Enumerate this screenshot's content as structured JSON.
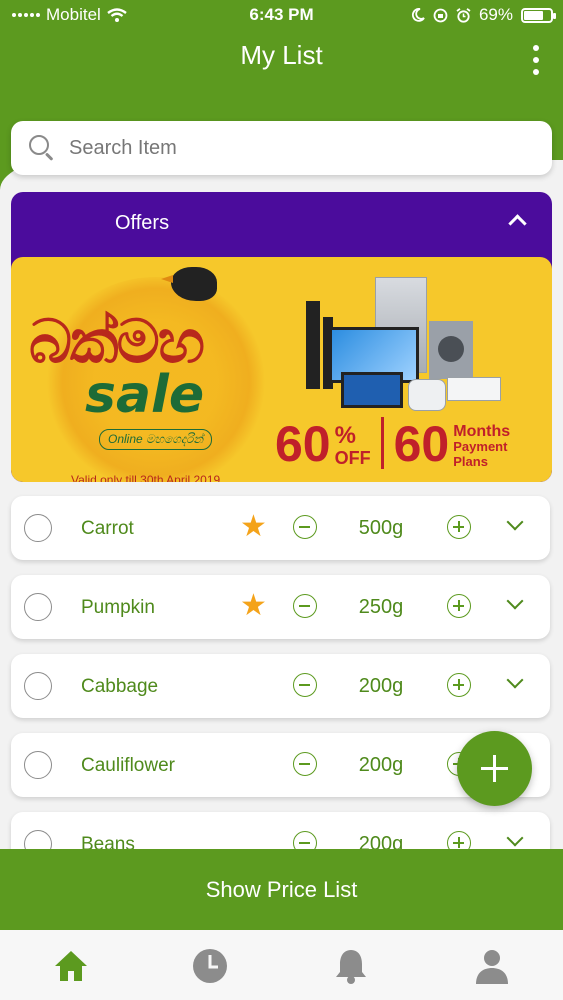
{
  "status_bar": {
    "carrier": "Mobitel",
    "time": "6:43 PM",
    "battery": "69%",
    "battery_level": 0.69
  },
  "header": {
    "title": "My List"
  },
  "search": {
    "placeholder": "Search Item"
  },
  "offers": {
    "title": "Offers",
    "banner": {
      "title": "බක්මහ",
      "sale": "sale",
      "subtitle": "Online මහගෙදරින්",
      "valid": "Valid only till 30th April 2019",
      "discount": "60",
      "discount_unit": "%",
      "discount_label": "OFF",
      "months": "60",
      "months_label_1": "Months",
      "months_label_2": "Payment",
      "months_label_3": "Plans"
    }
  },
  "items": [
    {
      "name": "Carrot",
      "quantity": "500g",
      "starred": true
    },
    {
      "name": "Pumpkin",
      "quantity": "250g",
      "starred": true
    },
    {
      "name": "Cabbage",
      "quantity": "200g",
      "starred": false
    },
    {
      "name": "Cauliflower",
      "quantity": "200g",
      "starred": false
    },
    {
      "name": "Beans",
      "quantity": "200g",
      "starred": false
    }
  ],
  "footer": {
    "price_button": "Show Price List"
  },
  "tabs": [
    {
      "icon": "home-icon",
      "active": true
    },
    {
      "icon": "clock-icon",
      "active": false
    },
    {
      "icon": "bell-icon",
      "active": false
    },
    {
      "icon": "user-icon",
      "active": false
    }
  ],
  "colors": {
    "primary": "#5c9a1f",
    "offers_bg": "#4b0c9c",
    "star": "#f4a31a",
    "inactive_tab": "#8c8c8c"
  }
}
